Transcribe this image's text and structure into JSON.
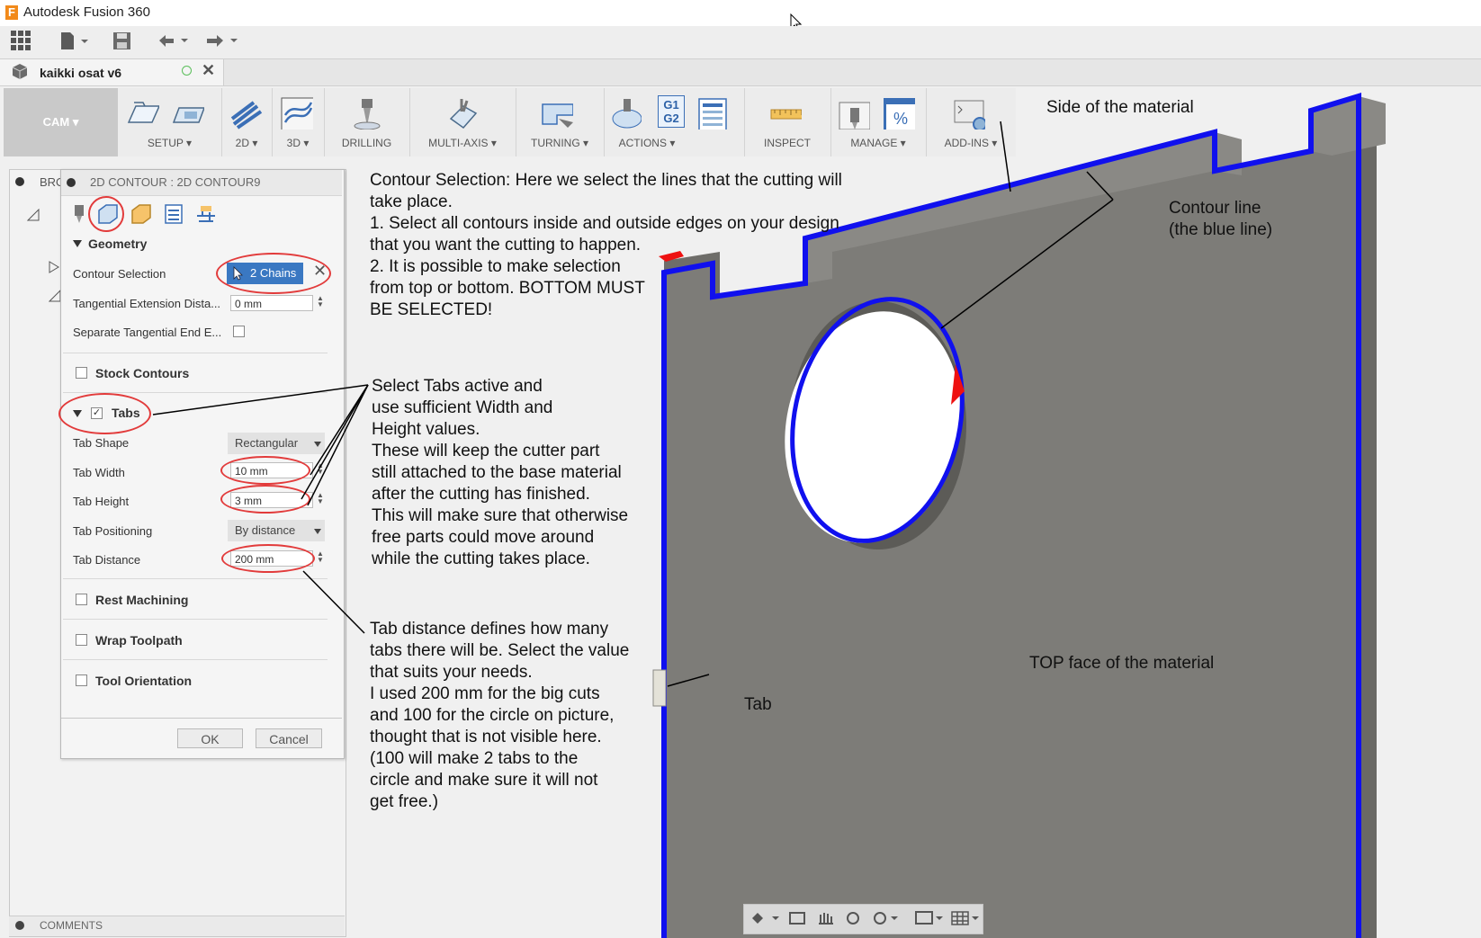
{
  "window": {
    "title": "Autodesk Fusion 360",
    "app_initial": "F"
  },
  "document_tab": {
    "label": "kaikki osat v6"
  },
  "toolbar": {
    "workspace": "CAM ▾",
    "groups": [
      "SETUP ▾",
      "2D ▾",
      "3D ▾",
      "DRILLING",
      "MULTI-AXIS ▾",
      "TURNING ▾",
      "ACTIONS ▾",
      "INSPECT",
      "MANAGE ▾",
      "ADD-INS ▾"
    ],
    "actions_icon_text": "G1\nG2"
  },
  "browser": {
    "label": "BRO",
    "comments": "COMMENTS"
  },
  "dialog": {
    "title": "2D CONTOUR : 2D CONTOUR9",
    "geometry": "Geometry",
    "contour_selection_label": "Contour Selection",
    "contour_selection_value": "2 Chains",
    "tangential_extension_label": "Tangential Extension Dista...",
    "tangential_extension_value": "0 mm",
    "separate_tangential_label": "Separate Tangential End E...",
    "stock_contours": "Stock Contours",
    "tabs": "Tabs",
    "tab_shape_label": "Tab Shape",
    "tab_shape_value": "Rectangular",
    "tab_width_label": "Tab Width",
    "tab_width_value": "10 mm",
    "tab_height_label": "Tab Height",
    "tab_height_value": "3 mm",
    "tab_positioning_label": "Tab Positioning",
    "tab_positioning_value": "By distance",
    "tab_distance_label": "Tab Distance",
    "tab_distance_value": "200 mm",
    "rest_machining": "Rest Machining",
    "wrap_toolpath": "Wrap Toolpath",
    "tool_orientation": "Tool Orientation",
    "ok": "OK",
    "cancel": "Cancel"
  },
  "annotations": {
    "contour_selection": "Contour Selection: Here we select the lines that the cutting will\ntake place.\n1. Select all contours inside and outside edges on your design\nthat you want the cutting to happen.\n2. It is possible to make selection\nfrom top or bottom. BOTTOM MUST\nBE SELECTED!",
    "tabs": "Select Tabs active and\nuse sufficient Width and\nHeight values.\nThese will keep the cutter part\nstill attached to the base material\nafter the cutting has finished.\nThis will make sure that otherwise\nfree parts could move around\nwhile the cutting takes place.",
    "tab_distance": "Tab distance defines how many\ntabs there will be. Select the value\nthat suits your needs.\nI used 200 mm for the big cuts\nand 100 for the circle on picture,\nthought that is not visible here.\n(100 will make 2 tabs to the\ncircle and make sure it will not\nget free.)",
    "side_of_material": "Side of the material",
    "contour_line": "Contour line\n(the blue line)",
    "top_face": "TOP face of the material",
    "tab": "Tab"
  },
  "colors": {
    "accent_blue": "#3a78c2",
    "contour_blue": "#1010ee",
    "annotation_red": "#e23b3b",
    "material_gray": "#7d7c78"
  }
}
